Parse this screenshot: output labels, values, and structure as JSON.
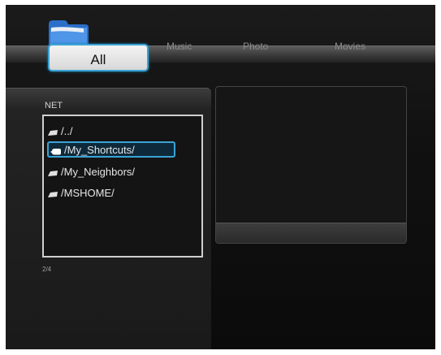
{
  "tabs": [
    {
      "label": "All",
      "active": true
    },
    {
      "label": "Music"
    },
    {
      "label": "Photo"
    },
    {
      "label": "Movies"
    }
  ],
  "browser": {
    "location": "NET",
    "items": [
      {
        "label": "/../"
      },
      {
        "label": "/My_Shortcuts/",
        "selected": true
      },
      {
        "label": "/My_Neighbors/"
      },
      {
        "label": "/MSHOME/"
      }
    ],
    "page_count": "2/4"
  },
  "colors": {
    "accent": "#3aa3d6",
    "background": "#111111",
    "text": "#e6e6e6"
  },
  "icons": {
    "category": "folder-icon",
    "item": "drive-icon",
    "selected_item": "hand-pointer-icon"
  }
}
